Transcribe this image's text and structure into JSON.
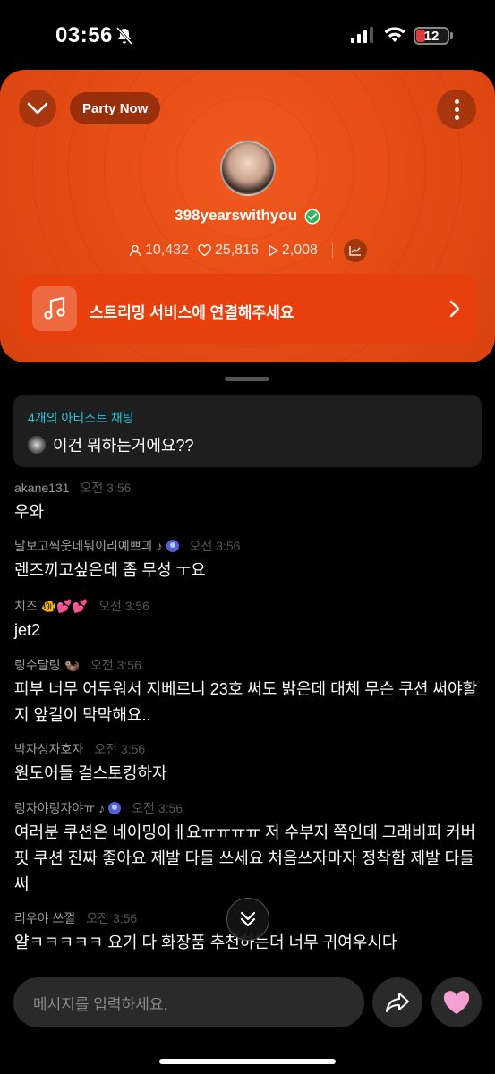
{
  "status_bar": {
    "time": "03:56",
    "battery": "12"
  },
  "header": {
    "pill_label": "Party Now"
  },
  "profile": {
    "username": "398yearswithyou",
    "listeners": "10,432",
    "likes": "25,816",
    "plays": "2,008"
  },
  "streaming": {
    "label": "스트리밍 서비스에 연결해주세요"
  },
  "artist_chat": {
    "title": "4개의 아티스트 채팅",
    "message": "이건 뭐하는거에요??"
  },
  "messages": [
    {
      "user": "akane131",
      "badges": "",
      "time": "오전 3:56",
      "text": "우와"
    },
    {
      "user": "날보고씩웃네뭐이리예쁘긔",
      "badges": "♪",
      "time": "오전 3:56",
      "text": "렌즈끼고싶은데 좀 무성 ㅜ요"
    },
    {
      "user": "치즈",
      "badges": "🐠💕💕",
      "time": "오전 3:56",
      "text": "jet2"
    },
    {
      "user": "링수달링",
      "badges": "🦦",
      "time": "오전 3:56",
      "text": "피부 너무 어두워서 지베르니 23호 써도 밝은데 대체 무슨 쿠션 써야할지 앞길이 막막해요.."
    },
    {
      "user": "박자성자호자",
      "badges": "",
      "time": "오전 3:56",
      "text": "원도어들 걸스토킹하자"
    },
    {
      "user": "링자야링자야ㅠ",
      "badges": "♪",
      "time": "오전 3:56",
      "text": "여러분 쿠션은 네이밍이ㅔ요ㅠㅠㅠㅠ 저 수부지 쪽인데 그래비피 커버핏 쿠션 진짜 좋아요 제발 다들 쓰세요 처음쓰자마자 정착함 제발 다들 써"
    },
    {
      "user": "리우야 쓰껄",
      "badges": "",
      "time": "오전 3:56",
      "text": "얄ㅋㅋㅋㅋㅋ 요기 다 화장품 추천하는더 너무 귀여우시다"
    }
  ],
  "composer": {
    "placeholder": "메시지를 입력하세요."
  },
  "colors": {
    "accent": "#e8400c",
    "chat_title": "#2ec4d8",
    "heart": "#f4a0d0"
  }
}
